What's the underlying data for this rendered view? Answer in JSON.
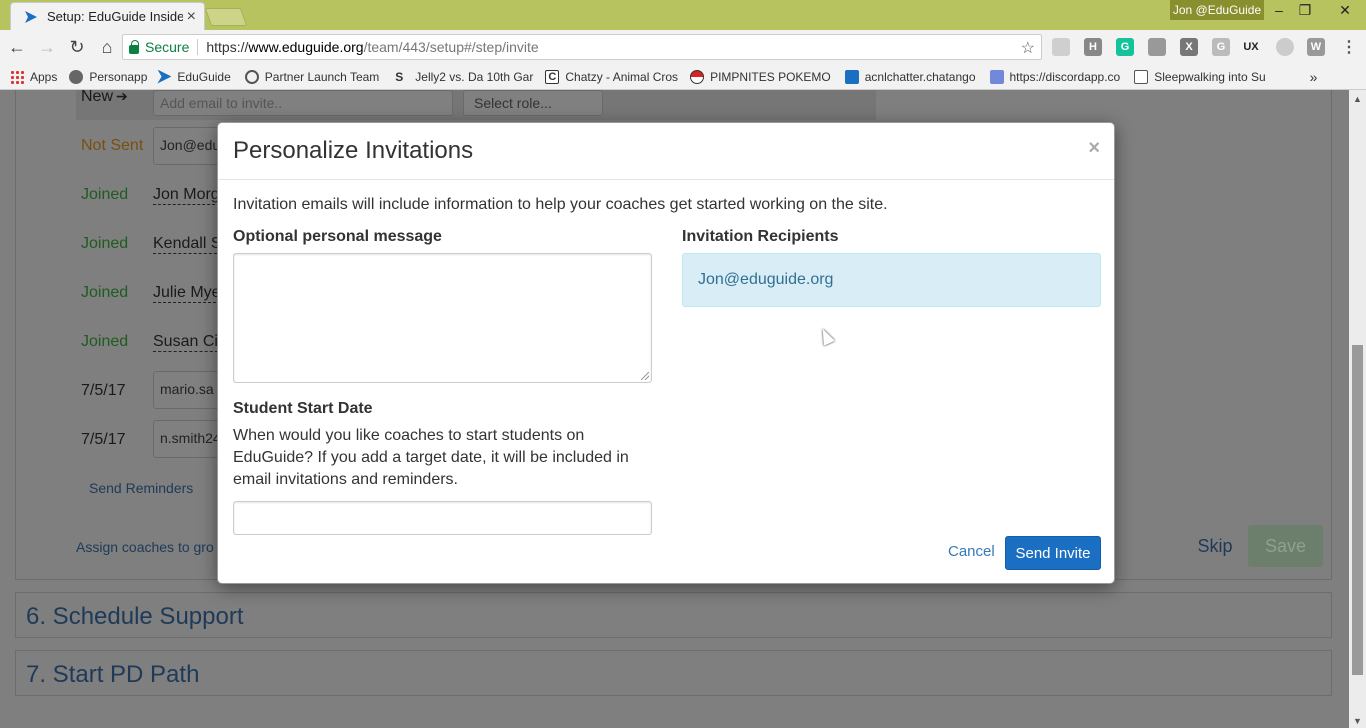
{
  "browser": {
    "tab_title": "Setup: EduGuide Insiders",
    "tab_close": "×",
    "user_badge": "Jon @EduGuide",
    "secure_label": "Secure",
    "url_scheme": "https://",
    "url_host": "www.eduguide.org",
    "url_path": "/team/443/setup#/step/invite",
    "bookmarks": [
      {
        "label": "Apps",
        "icon": "apps-grid-icon"
      },
      {
        "label": "Personapp",
        "icon": "personapp-icon"
      },
      {
        "label": "EduGuide",
        "icon": "eduguide-icon"
      },
      {
        "label": "Partner Launch Team",
        "icon": "partner-icon"
      },
      {
        "label": "Jelly2 vs. Da 10th Gar",
        "icon": "jelly-icon"
      },
      {
        "label": "Chatzy - Animal Cros",
        "icon": "chatzy-icon"
      },
      {
        "label": "PIMPNITES POKEMO",
        "icon": "pokeball-icon"
      },
      {
        "label": "acnlchatter.chatango",
        "icon": "chatango-icon"
      },
      {
        "label": "https://discordapp.co",
        "icon": "discord-icon"
      },
      {
        "label": "Sleepwalking into Su",
        "icon": "page-icon"
      }
    ],
    "overflow": "»"
  },
  "background": {
    "new_label": "New",
    "email_placeholder": "Add email  to invite..",
    "role_placeholder": "Select role...",
    "rows": [
      {
        "status": "Not Sent",
        "name": "Jon@edu"
      },
      {
        "status": "Joined",
        "name": "Jon Morg"
      },
      {
        "status": "Joined",
        "name": "Kendall S"
      },
      {
        "status": "Joined",
        "name": "Julie Mye"
      },
      {
        "status": "Joined",
        "name": "Susan Ci"
      },
      {
        "status": "7/5/17",
        "name": "mario.sa"
      },
      {
        "status": "7/5/17",
        "name": "n.smith24"
      }
    ],
    "send_reminders": "Send Reminders",
    "assign_coaches": "Assign coaches to gro",
    "skip": "Skip",
    "save": "Save",
    "sections": [
      "6. Schedule Support",
      "7. Start PD Path"
    ]
  },
  "modal": {
    "title": "Personalize Invitations",
    "close": "×",
    "intro": "Invitation emails will include information to help your coaches get started working on the site.",
    "message_label": "Optional personal message",
    "message_value": "",
    "start_date_label": "Student Start Date",
    "start_date_help": "When would you like coaches to start students on EduGuide? If you add a target date, it will be included in email invitations and reminders.",
    "start_date_value": "",
    "recipients_label": "Invitation Recipients",
    "recipients": [
      "Jon@eduguide.org"
    ],
    "cancel_label": "Cancel",
    "send_label": "Send Invite"
  },
  "colors": {
    "accent": "#1a6fc2",
    "recipient_bg": "#d9edf7",
    "recipient_text": "#31708f",
    "joined": "#1f5c1f",
    "not_sent": "#7a4f10"
  }
}
